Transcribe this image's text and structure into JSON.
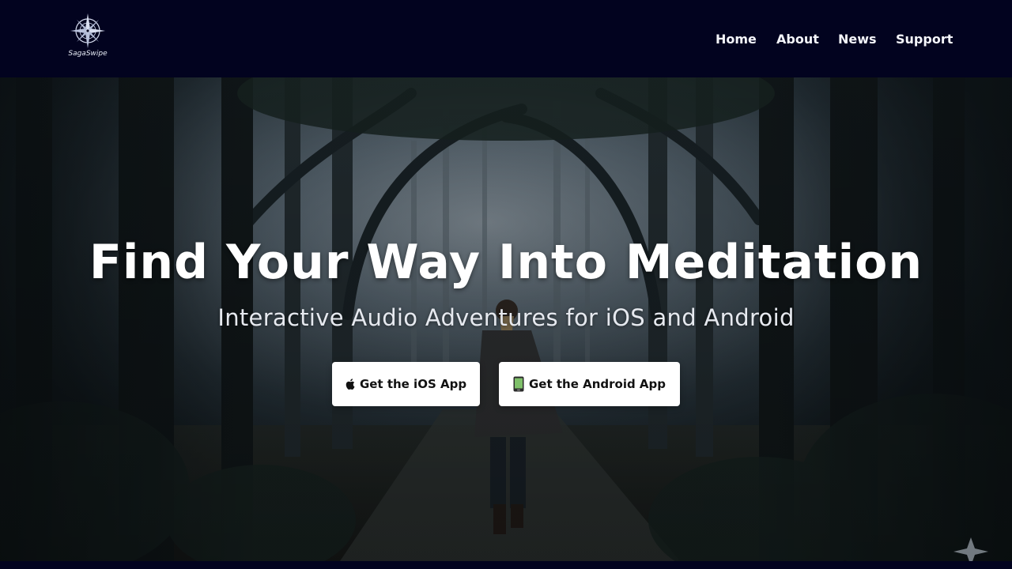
{
  "header": {
    "logo_text": "SagaSwipe",
    "nav": [
      {
        "label": "Home"
      },
      {
        "label": "About"
      },
      {
        "label": "News"
      },
      {
        "label": "Support"
      }
    ]
  },
  "hero": {
    "title": "Find Your Way Into Meditation",
    "subtitle": "Interactive Audio Adventures for iOS and Android",
    "buttons": {
      "ios": {
        "label": "Get the iOS App",
        "icon": "apple-icon"
      },
      "android": {
        "label": "Get the Android App",
        "icon": "mobile-phone-icon"
      }
    },
    "background": "misty-forest-path-photo"
  },
  "colors": {
    "header_bg": "#02031f",
    "button_bg": "#ffffff",
    "text_light": "#ffffff"
  }
}
